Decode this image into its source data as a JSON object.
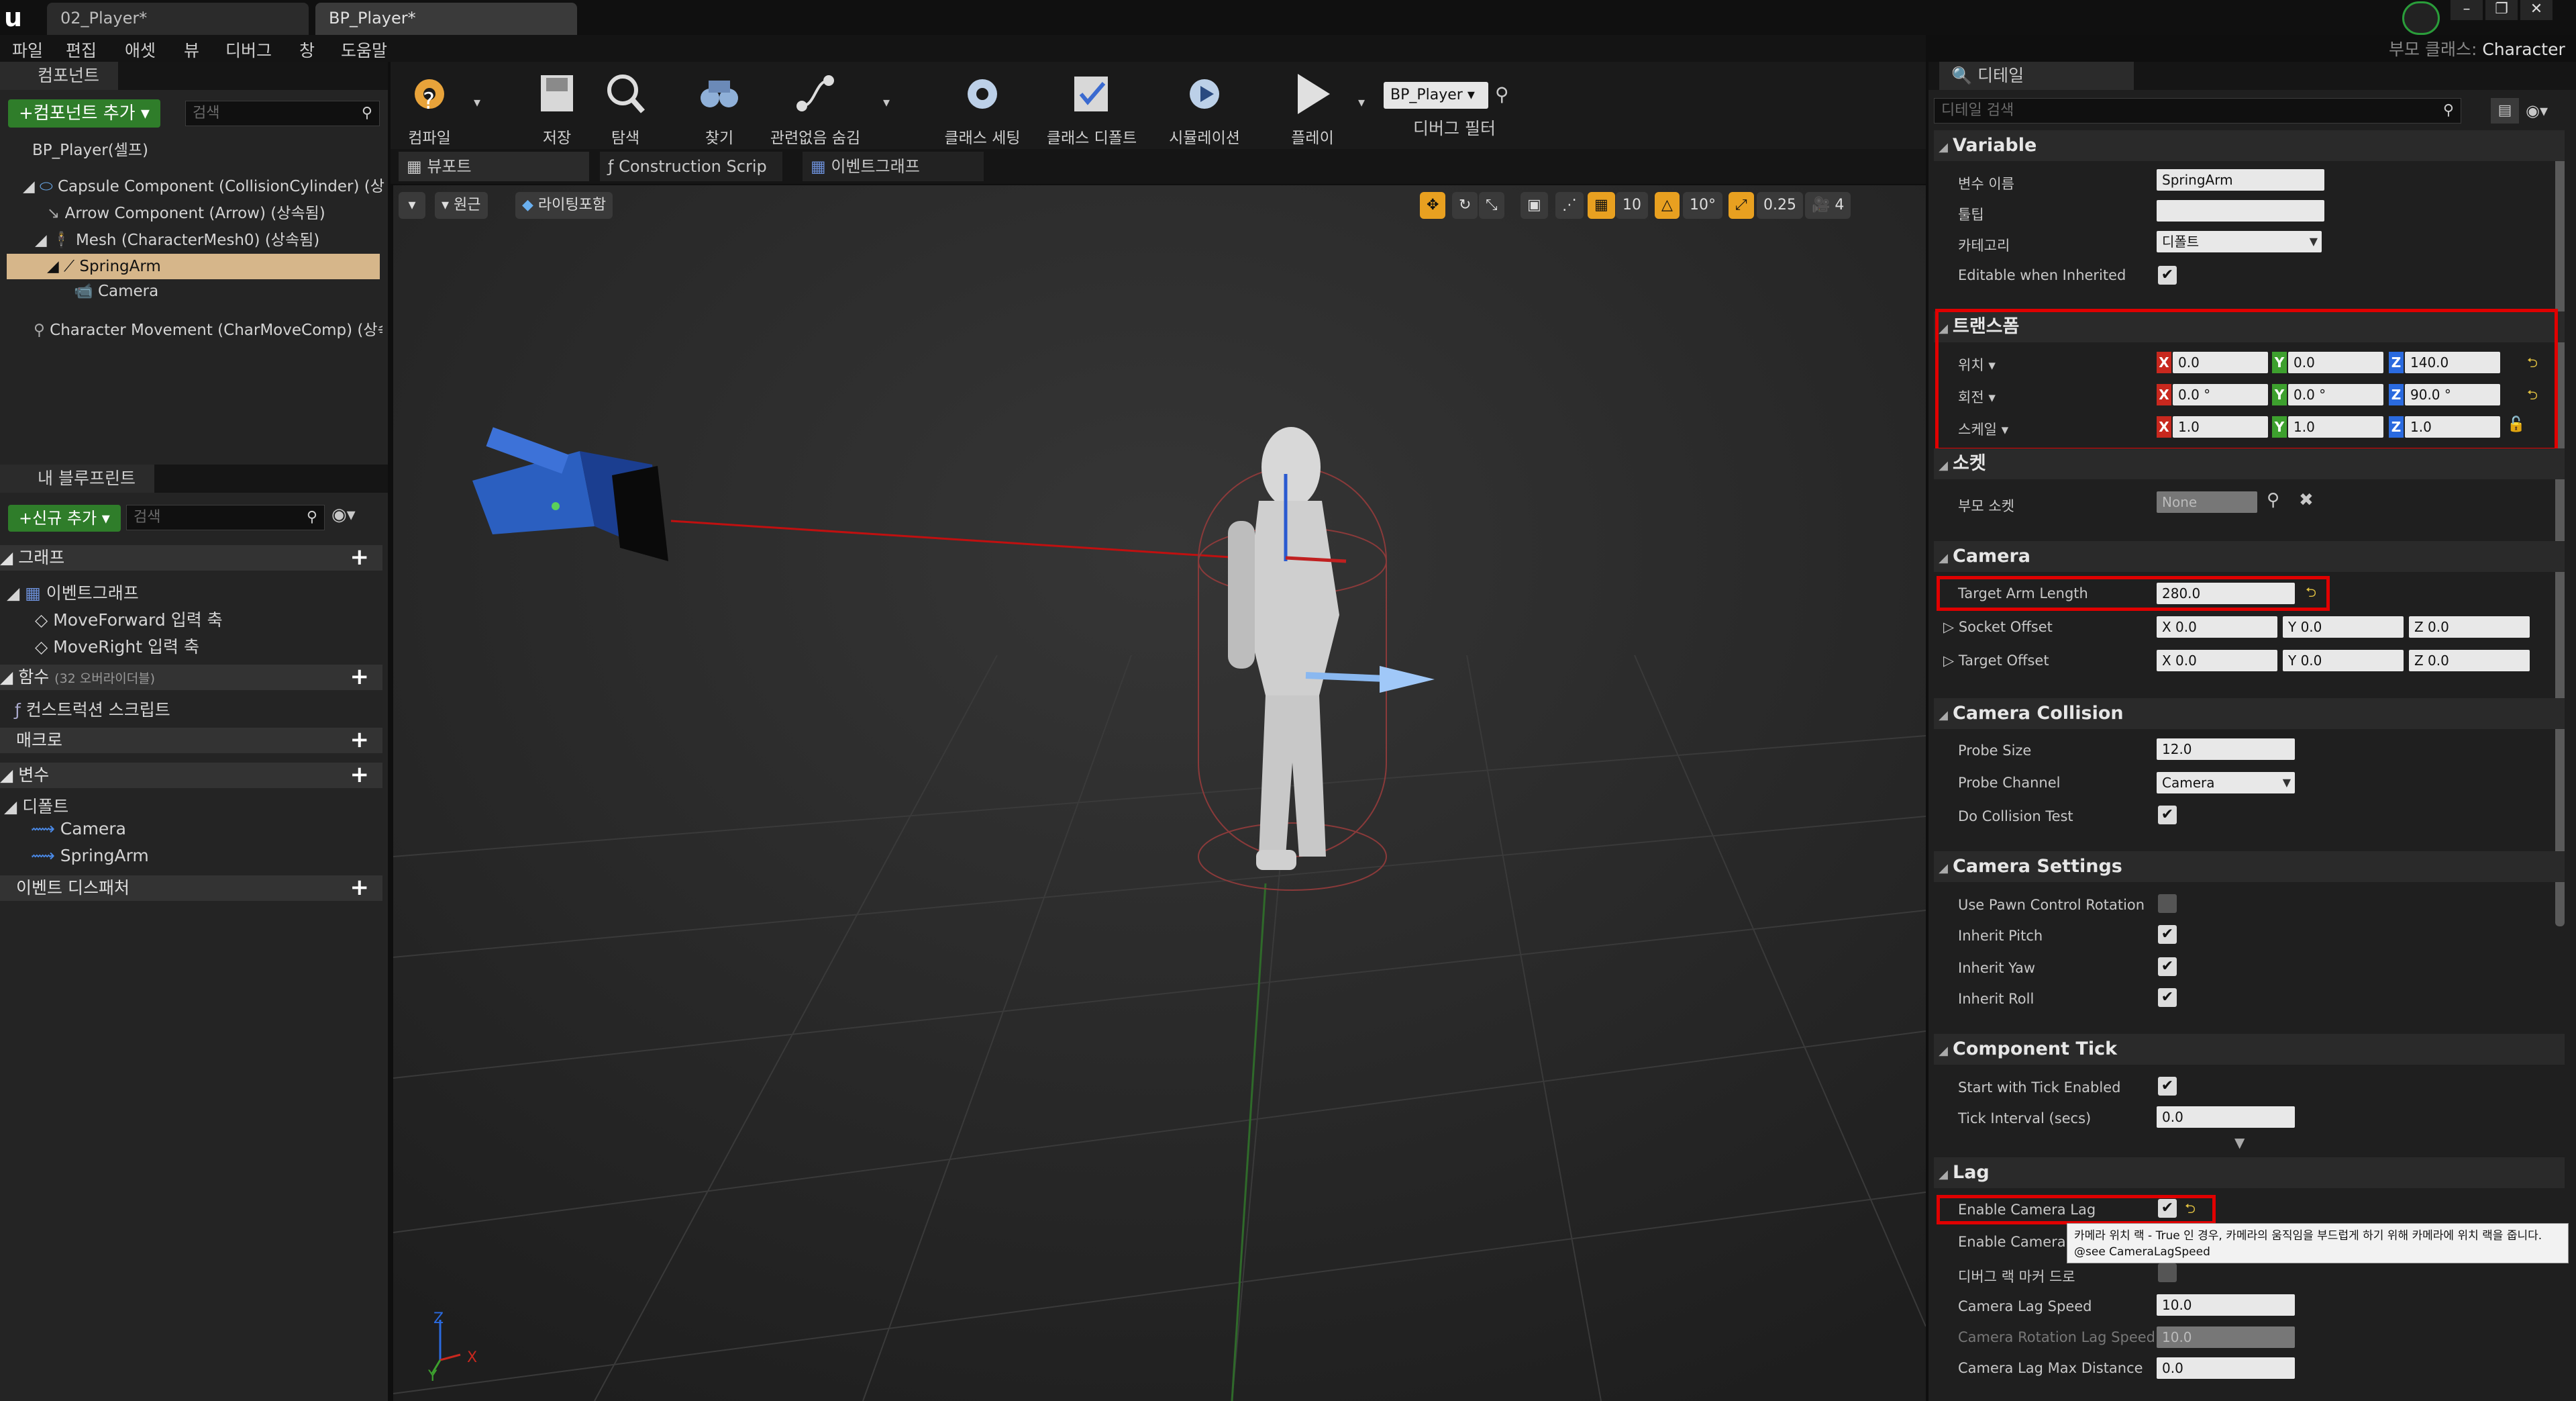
{
  "window": {
    "tabs": [
      "02_Player*",
      "BP_Player*"
    ],
    "parent_class_label": "부모 클래스:",
    "parent_class_value": "Character"
  },
  "menu": [
    "파일",
    "편집",
    "애셋",
    "뷰",
    "디버그",
    "창",
    "도움말"
  ],
  "components": {
    "tab": "컴포넌트",
    "add_button": "+컴포넌트 추가",
    "search_placeholder": "검색",
    "self": "BP_Player(셀프)",
    "items": [
      "Capsule Component (CollisionCylinder) (상속",
      "Arrow Component (Arrow) (상속됨)",
      "Mesh (CharacterMesh0) (상속됨)",
      "SpringArm",
      "Camera",
      "Character Movement (CharMoveComp) (상속"
    ]
  },
  "my_blueprint": {
    "tab": "내 블루프린트",
    "add_button": "+신규 추가",
    "search_placeholder": "검색",
    "graph": "그래프",
    "event_graph": "이벤트그래프",
    "graph_items": [
      "MoveForward 입력 축",
      "MoveRight 입력 축"
    ],
    "functions": "함수",
    "functions_note": "(32 오버라이더블)",
    "construction": "컨스트럭션 스크립트",
    "macros": "매크로",
    "variables": "변수",
    "defaults": "디폴트",
    "var_items": [
      "Camera",
      "SpringArm"
    ],
    "dispatchers": "이벤트 디스패처"
  },
  "toolbar": {
    "compile": "컴파일",
    "save": "저장",
    "browse": "탐색",
    "find": "찾기",
    "hide_unrelated": "관련없음 숨김",
    "class_settings": "클래스 세팅",
    "class_defaults": "클래스 디폴트",
    "simulation": "시뮬레이션",
    "play": "플레이",
    "debug_object": "BP_Player",
    "debug_filter": "디버그 필터"
  },
  "editor_tabs": [
    "뷰포트",
    "Construction Scrip",
    "이벤트그래프"
  ],
  "viewport": {
    "perspective": "원근",
    "lit": "라이팅포함",
    "grid": "10",
    "rot": "10°",
    "scale": "0.25",
    "speed": "4",
    "axis_x": "X",
    "axis_z": "Z",
    "axis_y": "Y"
  },
  "details": {
    "tab": "디테일",
    "search_placeholder": "디테일 검색",
    "variable": {
      "title": "Variable",
      "name_label": "변수 이름",
      "name_value": "SpringArm",
      "tooltip_label": "툴팁",
      "tooltip_value": "",
      "category_label": "카테고리",
      "category_value": "디폴트",
      "editable_label": "Editable when Inherited"
    },
    "transform": {
      "title": "트랜스폼",
      "location": "위치",
      "rotation": "회전",
      "scale": "스케일",
      "loc": [
        "0.0",
        "0.0",
        "140.0"
      ],
      "rot": [
        "0.0 °",
        "0.0 °",
        "90.0 °"
      ],
      "scl": [
        "1.0",
        "1.0",
        "1.0"
      ]
    },
    "socket": {
      "title": "소켓",
      "parent_label": "부모 소켓",
      "parent_value": "None"
    },
    "camera": {
      "title": "Camera",
      "arm_label": "Target Arm Length",
      "arm_value": "280.0",
      "socket_label": "Socket Offset",
      "target_label": "Target Offset",
      "socket": [
        "X 0.0",
        "Y 0.0",
        "Z 0.0"
      ],
      "target": [
        "X 0.0",
        "Y 0.0",
        "Z 0.0"
      ]
    },
    "collision": {
      "title": "Camera Collision",
      "probe_size_label": "Probe Size",
      "probe_size": "12.0",
      "probe_channel_label": "Probe Channel",
      "probe_channel": "Camera",
      "do_test_label": "Do Collision Test"
    },
    "settings": {
      "title": "Camera Settings",
      "items": [
        "Use Pawn Control Rotation",
        "Inherit Pitch",
        "Inherit Yaw",
        "Inherit Roll"
      ]
    },
    "tick": {
      "title": "Component Tick",
      "start_label": "Start with Tick Enabled",
      "interval_label": "Tick Interval (secs)",
      "interval": "0.0"
    },
    "lag": {
      "title": "Lag",
      "enable_lag": "Enable Camera Lag",
      "enable_rot": "Enable Camera R",
      "debug_markers": "디버그 랙 마커 드로",
      "lag_speed_label": "Camera Lag Speed",
      "lag_speed": "10.0",
      "rot_speed_label": "Camera Rotation Lag Speed",
      "rot_speed": "10.0",
      "max_dist_label": "Camera Lag Max Distance",
      "max_dist": "0.0",
      "tooltip_line1": "카메라 위치 랙 - True 인 경우, 카메라의 움직임을 부드럽게 하기 위해 카메라에 위치 랙을 줍니다.",
      "tooltip_line2": "@see CameraLagSpeed"
    }
  },
  "colors": {
    "accent_red": "#e00000",
    "axis_x": "#c8281e",
    "axis_y": "#3da02e",
    "axis_z": "#2a6adf"
  }
}
